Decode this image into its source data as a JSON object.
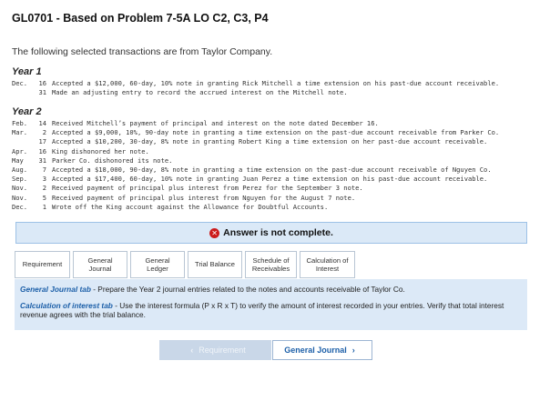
{
  "header": {
    "title": "GL0701 - Based on Problem 7-5A LO C2, C3, P4",
    "intro": "The following selected transactions are from Taylor Company."
  },
  "years": [
    {
      "label": "Year 1",
      "entries": [
        {
          "month": "Dec.",
          "day": "16",
          "text": "Accepted a $12,000, 60-day, 10% note in granting Rick Mitchell a time extension on his past-due account receivable."
        },
        {
          "month": "",
          "day": "31",
          "text": "Made an adjusting entry to record the accrued interest on the Mitchell note."
        }
      ]
    },
    {
      "label": "Year 2",
      "entries": [
        {
          "month": "Feb.",
          "day": "14",
          "text": "Received Mitchell’s payment of principal and interest on the note dated December 16."
        },
        {
          "month": "Mar.",
          "day": "2",
          "text": "Accepted a $9,000, 10%, 90-day note in granting a time extension on the past-due account receivable from Parker Co."
        },
        {
          "month": "",
          "day": "17",
          "text": "Accepted a $10,200, 30-day, 8% note in granting Robert King a time extension on her past-due account receivable."
        },
        {
          "month": "Apr.",
          "day": "16",
          "text": "King dishonored her note."
        },
        {
          "month": "May",
          "day": "31",
          "text": "Parker Co. dishonored its note."
        },
        {
          "month": "Aug.",
          "day": "7",
          "text": "Accepted a $18,000, 90-day, 8% note in granting a time extension on the past-due account receivable of Nguyen Co."
        },
        {
          "month": "Sep.",
          "day": "3",
          "text": "Accepted a $17,400, 60-day, 10% note in granting Juan Perez a time extension on his past-due account receivable."
        },
        {
          "month": "Nov.",
          "day": "2",
          "text": "Received payment of principal plus interest from Perez for the September 3 note."
        },
        {
          "month": "Nov.",
          "day": "5",
          "text": "Received payment of principal plus interest from Nguyen for the August 7 note."
        },
        {
          "month": "Dec.",
          "day": "1",
          "text": "Wrote off the King account against the Allowance for Doubtful Accounts."
        }
      ]
    }
  ],
  "status": {
    "icon": "x-circle-icon",
    "icon_color": "#cc1a1a",
    "text": "Answer is not complete."
  },
  "tabs": [
    {
      "line1": "Requirement",
      "line2": ""
    },
    {
      "line1": "General",
      "line2": "Journal"
    },
    {
      "line1": "General",
      "line2": "Ledger"
    },
    {
      "line1": "Trial Balance",
      "line2": ""
    },
    {
      "line1": "Schedule of",
      "line2": "Receivables"
    },
    {
      "line1": "Calculation of",
      "line2": "Interest"
    }
  ],
  "instructions": [
    {
      "term": "General Journal tab",
      "text": " - Prepare the Year 2 journal entries related to the notes and accounts receivable of Taylor Co."
    },
    {
      "term": "Calculation of interest tab",
      "text": " - Use the interest formula (P x R x T) to verify the amount of interest recorded in your entries. Verify that total interest revenue agrees with the trial balance."
    }
  ],
  "nav": {
    "prev_label": "Requirement",
    "next_label": "General Journal"
  },
  "colors": {
    "accent": "#1c5fa8",
    "panel_bg": "#dce9f7"
  }
}
